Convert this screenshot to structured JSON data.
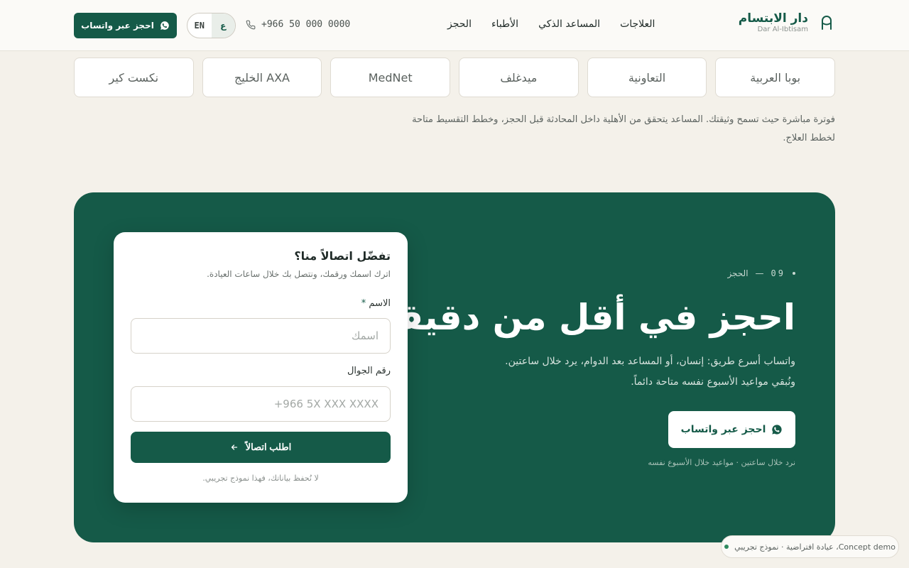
{
  "header": {
    "brand_name": "دار الابتسام",
    "brand_sub": "Dar Al-Ibtisam",
    "nav": [
      "العلاجات",
      "المساعد الذكي",
      "الأطباء",
      "الحجز"
    ],
    "phone": "+966 50 000 0000",
    "lang_en": "EN",
    "lang_ar": "ع",
    "cta": "احجز عبر واتساب"
  },
  "insurers": [
    "بوبا العربية",
    "التعاونية",
    "ميدغلف",
    "MedNet",
    "AXA الخليج",
    "نكست كير"
  ],
  "insurance_note": "فوترة مباشرة حيث تسمح وثيقتك. المساعد يتحقق من الأهلية داخل المحادثة قبل الحجز، وخطط التقسيط متاحة لخطط العلاج.",
  "booking": {
    "eyebrow_num": "09",
    "eyebrow_label": "الحجز",
    "headline": "احجز في أقل من دقيقة.",
    "lead_1": "واتساب أسرع طريق: إنسان، أو المساعد بعد الدوام، يرد خلال ساعتين.",
    "lead_2": "ونُبقي مواعيد الأسبوع نفسه متاحة دائماً.",
    "whatsapp_button": "احجز عبر واتساب",
    "fine_print": "نرد خلال ساعتين · مواعيد خلال الأسبوع نفسه"
  },
  "callback_form": {
    "title": "تفضّل اتصالاً منا؟",
    "subtitle": "اترك اسمك ورقمك، ونتصل بك خلال ساعات العيادة.",
    "name_label": "الاسم",
    "name_required": "*",
    "name_placeholder": "اسمك",
    "phone_label": "رقم الجوال",
    "phone_placeholder": "+966 5X XXX XXXX",
    "submit": "اطلب اتصالاً",
    "disclaimer": "لا نُحفظ بياناتك، فهذا نموذج تجريبي."
  },
  "demo_badge": "Concept demo، عيادة افتراضية · نموذج تجريبي",
  "colors": {
    "brand": "#155a48",
    "background": "#f4f1ea",
    "accent_dot": "#2f8a5f"
  }
}
